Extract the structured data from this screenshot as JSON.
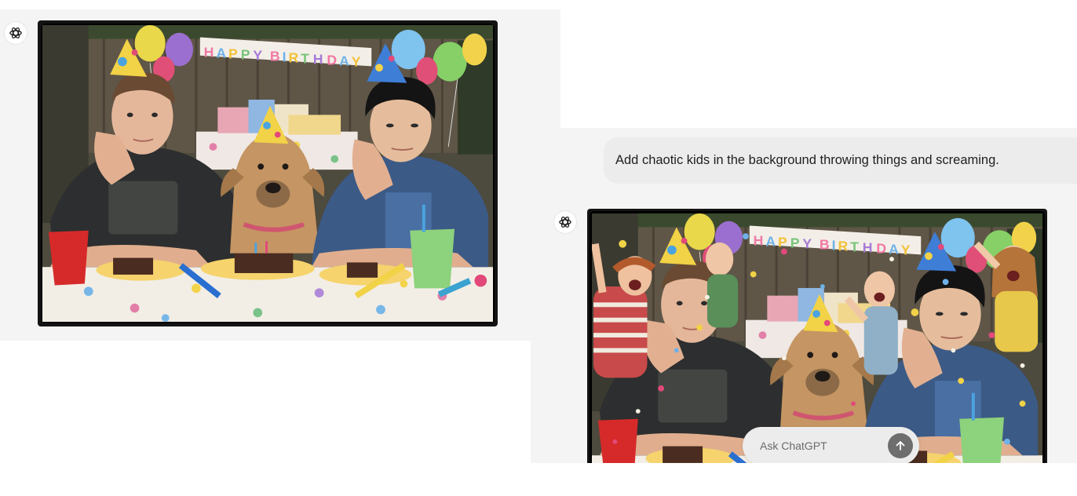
{
  "conversation": {
    "assistant_avatar_icon": "openai-logo-icon",
    "first_image": {
      "alt": "Two bored men wearing party hats at a birthday table with a dog"
    },
    "user_message": {
      "text": "Add chaotic kids in the background throwing things and screaming."
    },
    "second_image": {
      "alt": "Same birthday scene with chaotic kids in the background throwing things and screaming"
    }
  },
  "banner_text": "HAPPY BIRTHDAY",
  "composer": {
    "placeholder": "Ask ChatGPT",
    "send_icon": "arrow-up-icon"
  },
  "colors": {
    "card_background": "#f4f4f4",
    "bubble_background": "#ececec",
    "send_button": "#6e6e6e"
  }
}
